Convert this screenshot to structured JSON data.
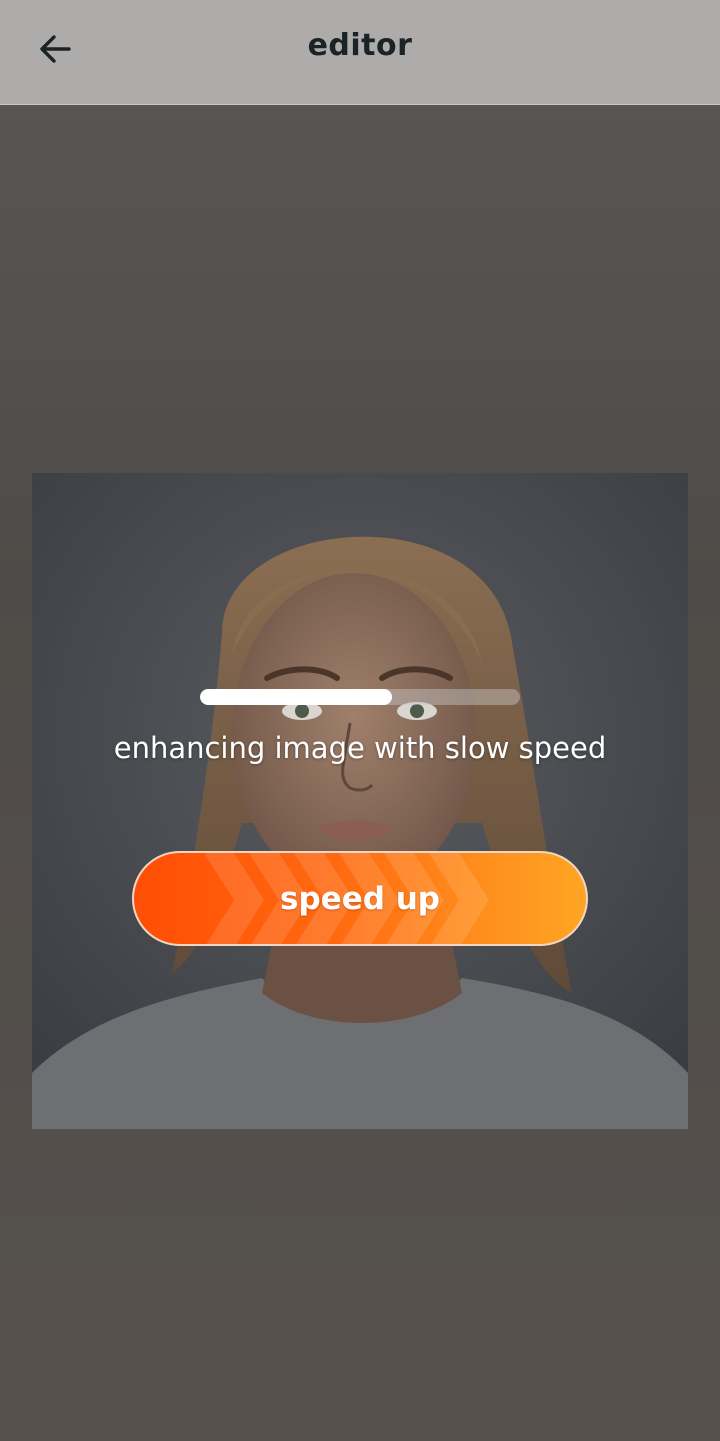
{
  "header": {
    "title": "editor",
    "back_icon": "arrow-left-icon"
  },
  "enhance": {
    "progress": 0.6,
    "status_text": "enhancing image with slow speed",
    "speed_up_label": "speed up"
  },
  "colors": {
    "accent_start": "#ff4d05",
    "accent_end": "#ffa524",
    "topbar": "#adacab"
  }
}
